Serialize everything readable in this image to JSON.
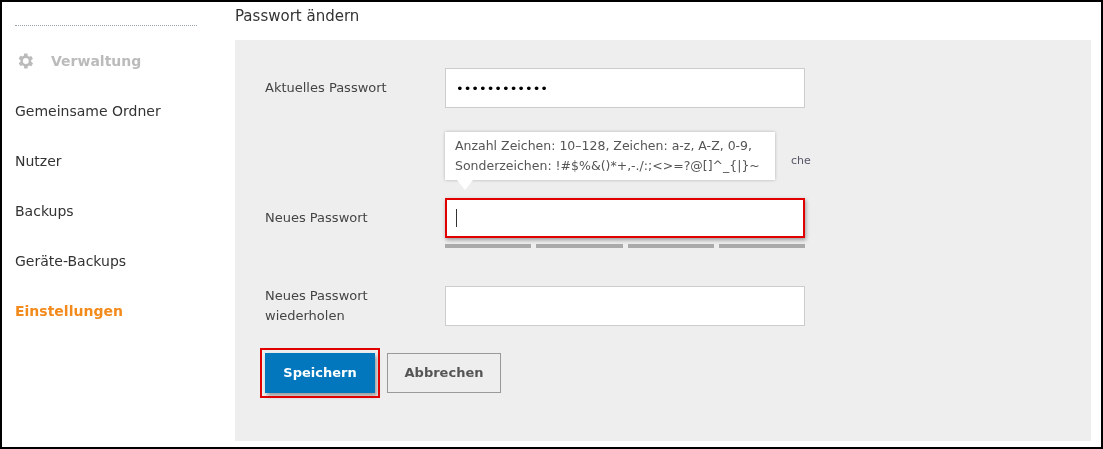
{
  "sidebar": {
    "header": {
      "label": "Verwaltung"
    },
    "items": [
      {
        "label": "Gemeinsame Ordner",
        "selected": false
      },
      {
        "label": "Nutzer",
        "selected": false
      },
      {
        "label": "Backups",
        "selected": false
      },
      {
        "label": "Geräte-Backups",
        "selected": false
      },
      {
        "label": "Einstellungen",
        "selected": true
      }
    ]
  },
  "page_title": "Passwort ändern",
  "form": {
    "fields": [
      {
        "label": "Aktuelles Passwort",
        "value": "••••••••••••",
        "highlighted": false
      },
      {
        "label": "Neues Passwort",
        "highlighted": true,
        "focused": true
      },
      {
        "label": "Neues Passwort wiederholen",
        "highlighted": false
      }
    ],
    "hint": {
      "fragment": "che"
    },
    "tooltip": "Anzahl Zeichen: 10–128, Zeichen: a-z, A-Z, 0-9, Sonderzeichen: !#$%&()*+,-./:;<>=?@[]^_{|}~",
    "buttons": [
      {
        "label": "Speichern",
        "kind": "primary",
        "highlighted": true
      },
      {
        "label": "Abbrechen",
        "kind": "secondary",
        "highlighted": false
      }
    ]
  }
}
